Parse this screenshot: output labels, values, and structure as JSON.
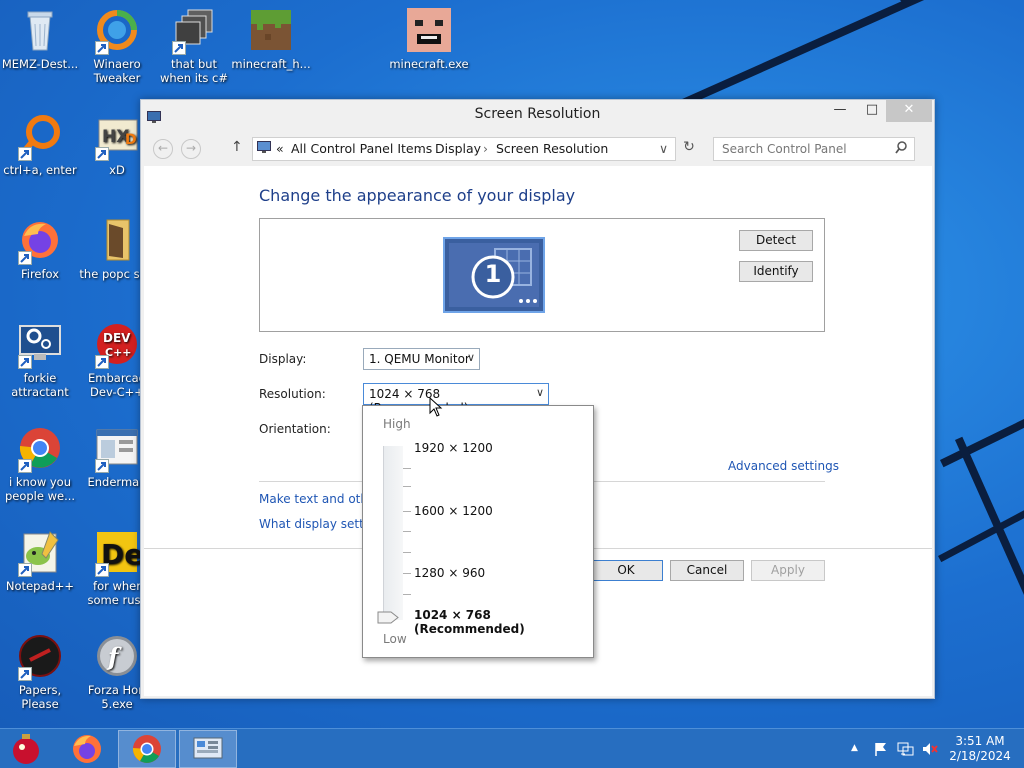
{
  "desktop_icons": [
    {
      "label": "MEMZ-Dest...",
      "icon": "recycle-bin-icon"
    },
    {
      "label": "Winaero Tweaker",
      "icon": "winaero-tweaker-icon"
    },
    {
      "label": "that but when its c#",
      "icon": "shortcut-windows-icon"
    },
    {
      "label": "minecraft_h...",
      "icon": "minecraft-grass-block-icon"
    },
    {
      "label": "minecraft.exe",
      "icon": "minecraft-face-icon"
    },
    {
      "label": "ctrl+a, enter",
      "icon": "orange-ring-icon"
    },
    {
      "label": "xD",
      "icon": "hxd-icon"
    },
    {
      "label": "Firefox",
      "icon": "firefox-icon"
    },
    {
      "label": "the popc shit",
      "icon": "folder-icon"
    },
    {
      "label": "forkie attractant",
      "icon": "monitor-gear-icon"
    },
    {
      "label": "Embarcad Dev-C++",
      "icon": "devcpp-icon"
    },
    {
      "label": "i know you people we...",
      "icon": "chrome-icon"
    },
    {
      "label": "Enderman",
      "icon": "window-icon"
    },
    {
      "label": "Notepad++",
      "icon": "notepadpp-icon"
    },
    {
      "label": "for wher some russ",
      "icon": "dl-icon"
    },
    {
      "label": "Papers, Please",
      "icon": "papers-please-icon"
    },
    {
      "label": "Forza Hori 5.exe",
      "icon": "flash-icon"
    }
  ],
  "window": {
    "title": "Screen Resolution",
    "controls": {
      "minimize": "—",
      "maximize": "□",
      "close": "✕"
    },
    "address": {
      "prefix": "«",
      "crumbs": [
        "All Control Panel Items",
        "Display",
        "Screen Resolution"
      ],
      "dropdown_glyph": "∨",
      "refresh_glyph": "↻"
    },
    "search_placeholder": "Search Control Panel"
  },
  "main": {
    "heading": "Change the appearance of your display",
    "monitor_number": "1",
    "detect_label": "Detect",
    "identify_label": "Identify",
    "display_label": "Display:",
    "display_value": "1. QEMU Monitor",
    "resolution_label": "Resolution:",
    "resolution_value": "1024 × 768 (Recommended)",
    "orientation_label": "Orientation:",
    "advanced_settings": "Advanced settings",
    "link_text_size": "Make text and other",
    "link_display_settings": "What display setting",
    "ok_label": "OK",
    "cancel_label": "Cancel",
    "apply_label": "Apply"
  },
  "resolution_dropdown": {
    "high_label": "High",
    "low_label": "Low",
    "options": [
      "1920 × 1200",
      "1600 × 1200",
      "1280 × 960",
      "1024 × 768 (Recommended)"
    ],
    "selected": "1024 × 768 (Recommended)",
    "slider_level": 0
  },
  "taskbar": {
    "items": [
      "memz-ornament-icon",
      "firefox-icon",
      "chrome-icon",
      "control-panel-icon"
    ],
    "active_item": "control-panel-icon",
    "tray": {
      "up_arrow": "▲"
    },
    "time": "3:51 AM",
    "date": "2/18/2024"
  },
  "colors": {
    "desktop_blue": "#1f73d3",
    "heading_blue": "#1e3f8a",
    "link_blue": "#1f56b4"
  }
}
